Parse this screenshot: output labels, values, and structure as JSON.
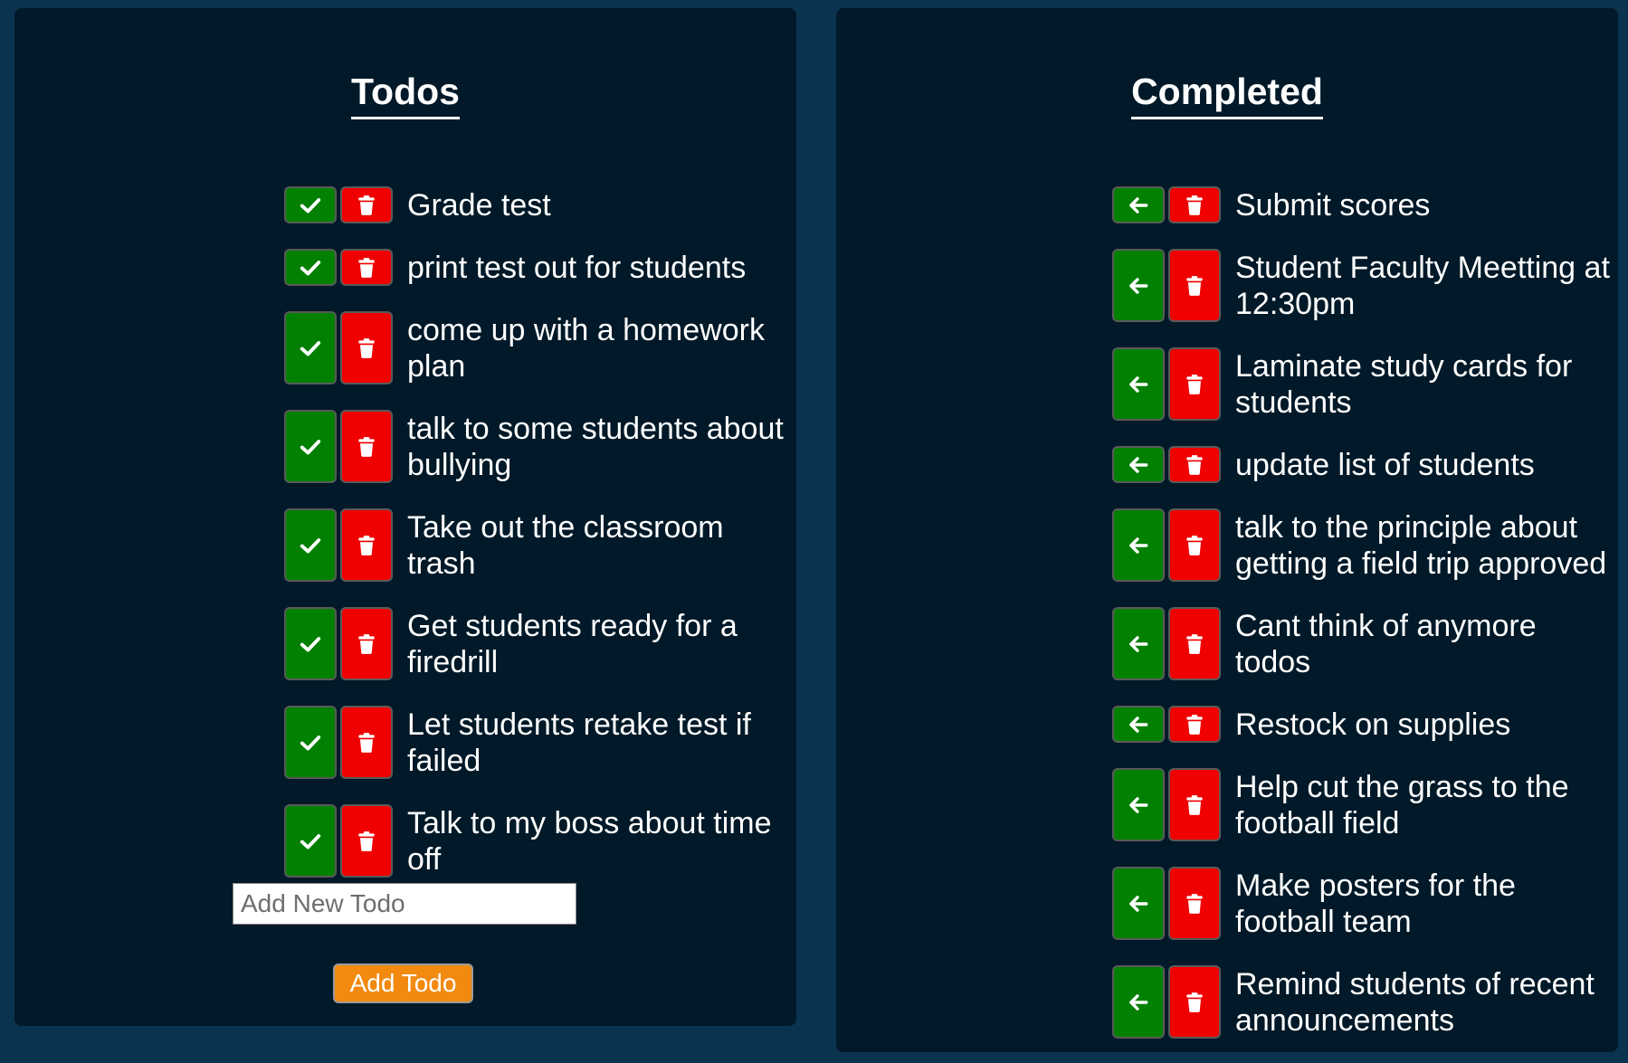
{
  "todos": {
    "title": "Todos",
    "items": [
      {
        "text": "Grade test"
      },
      {
        "text": "print test out for students"
      },
      {
        "text": "come up with a homework plan"
      },
      {
        "text": "talk to some students about bullying"
      },
      {
        "text": "Take out the classroom trash"
      },
      {
        "text": "Get students ready for a firedrill"
      },
      {
        "text": "Let students retake test if failed"
      },
      {
        "text": "Talk to my boss about time off"
      }
    ],
    "input_placeholder": "Add New Todo",
    "input_value": "",
    "add_button_label": "Add Todo"
  },
  "completed": {
    "title": "Completed",
    "items": [
      {
        "text": "Submit scores"
      },
      {
        "text": "Student Faculty Meetting at 12:30pm"
      },
      {
        "text": "Laminate study cards for students"
      },
      {
        "text": "update list of students"
      },
      {
        "text": "talk to the principle about getting a field trip approved"
      },
      {
        "text": "Cant think of anymore todos"
      },
      {
        "text": "Restock on supplies"
      },
      {
        "text": "Help cut the grass to the football field"
      },
      {
        "text": "Make posters for the football team"
      },
      {
        "text": "Remind students of recent announcements"
      }
    ]
  },
  "icons": {
    "todo_action": "check-icon",
    "completed_action": "arrow-left-icon",
    "delete_action": "trash-icon"
  },
  "colors": {
    "page_background": "#0a3350",
    "panel_background": "#011928",
    "complete_button": "#028002",
    "delete_button": "#f00000",
    "add_button": "#f28a10",
    "text": "#ffffff"
  }
}
